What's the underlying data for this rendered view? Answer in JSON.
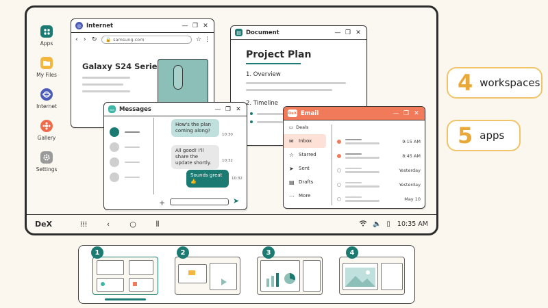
{
  "dock": [
    {
      "label": "Apps",
      "icon": "apps-grid-icon",
      "color": "#1b7b72",
      "glyph": "⁝⁝"
    },
    {
      "label": "My Files",
      "icon": "folder-icon",
      "color": "#f3b63f",
      "glyph": "▬"
    },
    {
      "label": "Internet",
      "icon": "internet-icon",
      "color": "#4a5bb8",
      "glyph": "◎"
    },
    {
      "label": "Gallery",
      "icon": "gallery-icon",
      "color": "#ef6a4a",
      "glyph": "✿"
    },
    {
      "label": "Settings",
      "icon": "gear-icon",
      "color": "#8a8a8a",
      "glyph": "⚙"
    }
  ],
  "internet": {
    "title": "Internet",
    "url": "samsung.com",
    "heading": "Galaxy S24 Series"
  },
  "document": {
    "title": "Document",
    "heading": "Project Plan",
    "section1": "1. Overview",
    "section2": "2. Timeline"
  },
  "messages": {
    "title": "Messages",
    "bubbles": [
      {
        "text": "How's the plan coming along?",
        "time": "10:30",
        "side": "left"
      },
      {
        "text": "All good! I'll share the update shortly.",
        "time": "10:32",
        "side": "left"
      },
      {
        "text": "Sounds great 👍",
        "time": "10:32",
        "side": "right"
      }
    ]
  },
  "email": {
    "title": "Email",
    "brand": "DeX",
    "account": "Deals",
    "nav": [
      {
        "label": "Inbox",
        "glyph": "✉"
      },
      {
        "label": "Starred",
        "glyph": "☆"
      },
      {
        "label": "Sent",
        "glyph": "➤"
      },
      {
        "label": "Drafts",
        "glyph": "▤"
      },
      {
        "label": "More",
        "glyph": "⋯"
      }
    ],
    "rows": [
      {
        "time": "9:15 AM",
        "unread": true
      },
      {
        "time": "8:45 AM",
        "unread": true
      },
      {
        "time": "Yesterday",
        "unread": false
      },
      {
        "time": "Yesterday",
        "unread": false
      },
      {
        "time": "May 10",
        "unread": false
      }
    ]
  },
  "taskbar": {
    "brand": "DeX",
    "clock": "10:35 AM"
  },
  "stats": [
    {
      "number": "4",
      "label": "workspaces"
    },
    {
      "number": "5",
      "label": "apps"
    }
  ],
  "workspaces": [
    "1",
    "2",
    "3",
    "4"
  ],
  "colors": {
    "accent": "#1b7b72",
    "email": "#f07a5a",
    "stat_border": "#f1c46a",
    "stat_number": "#e8a93a"
  }
}
